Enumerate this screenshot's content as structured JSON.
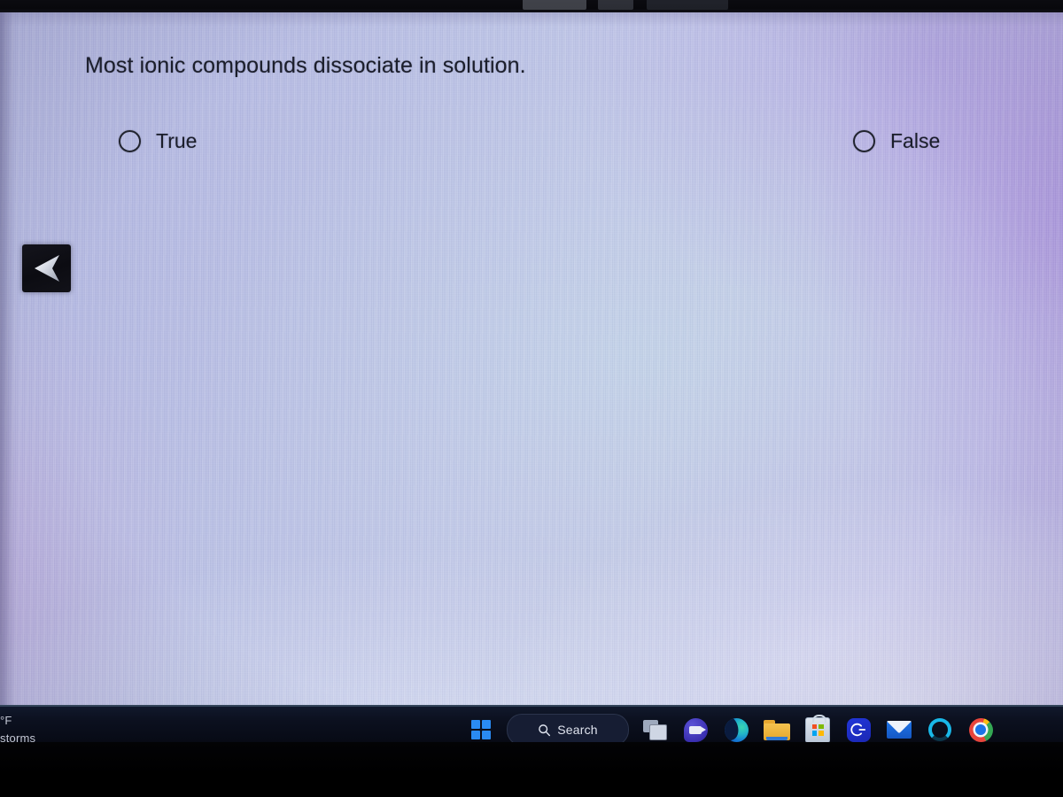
{
  "question": {
    "text": "Most ionic compounds dissociate in solution.",
    "choices": [
      {
        "label": "True",
        "selected": false,
        "icon": "radio-unselected-icon"
      },
      {
        "label": "False",
        "selected": false,
        "icon": "radio-unselected-icon"
      }
    ]
  },
  "overlay": {
    "back_arrow_icon": "back-arrow-icon"
  },
  "taskbar": {
    "weather": {
      "temperature": "°F",
      "condition": "storms"
    },
    "start_button": {
      "label": "Start",
      "icon": "windows-logo-icon"
    },
    "search": {
      "label": "Search",
      "icon": "search-icon",
      "placeholder": "Search"
    },
    "items": [
      {
        "name": "task-view",
        "label": "Task View",
        "icon": "task-view-icon",
        "running": false
      },
      {
        "name": "teams",
        "label": "Chat",
        "icon": "teams-chat-icon",
        "running": false
      },
      {
        "name": "microsoft-edge",
        "label": "Microsoft Edge",
        "icon": "edge-icon",
        "running": false
      },
      {
        "name": "file-explorer",
        "label": "File Explorer",
        "icon": "folder-icon",
        "running": false
      },
      {
        "name": "microsoft-store",
        "label": "Microsoft Store",
        "icon": "store-icon",
        "running": false
      },
      {
        "name": "search-app",
        "label": "Search",
        "icon": "magnifier-app-icon",
        "running": false
      },
      {
        "name": "mail",
        "label": "Mail",
        "icon": "mail-envelope-icon",
        "running": false
      },
      {
        "name": "copilot",
        "label": "Copilot",
        "icon": "copilot-ring-icon",
        "running": false
      },
      {
        "name": "google-chrome",
        "label": "Google Chrome",
        "icon": "chrome-icon",
        "running": true
      }
    ]
  },
  "colors": {
    "screen_base": "#bcc3e6",
    "screen_purple_glow": "#a88cde",
    "taskbar_bg": "#0c1120",
    "text_dark": "#1b1e2b",
    "accent_blue": "#2a8bf2",
    "bezel_black": "#000000"
  }
}
